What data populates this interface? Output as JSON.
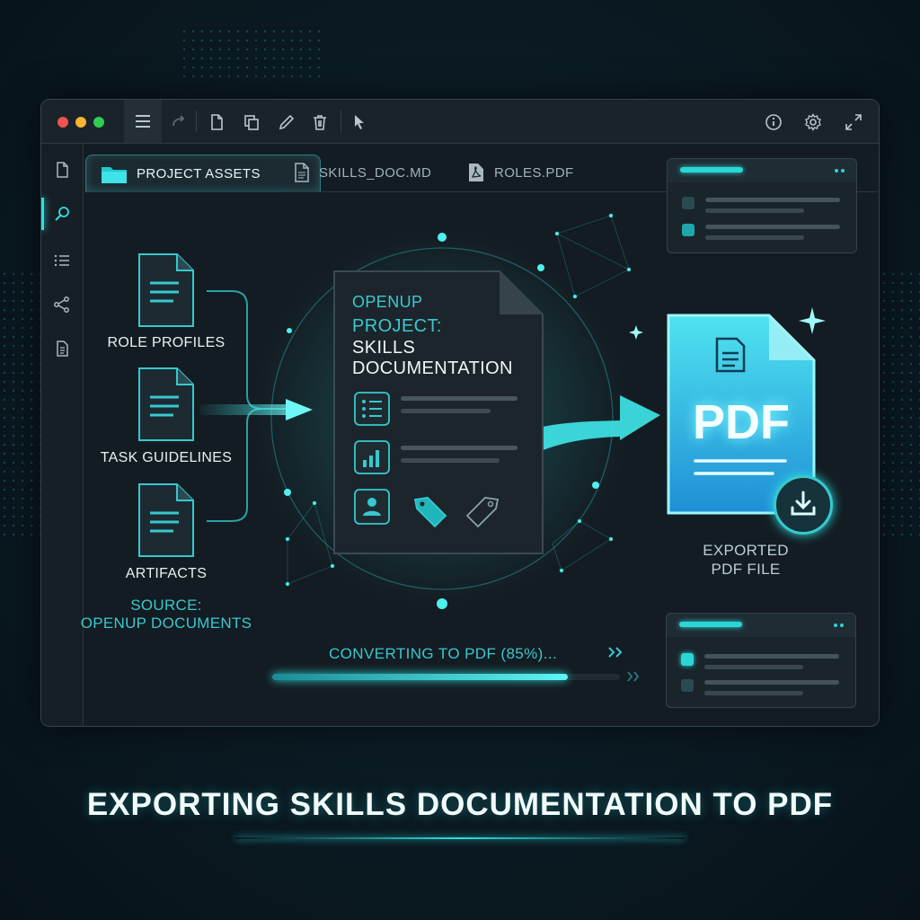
{
  "toolbar": {
    "icons": [
      "menu-icon",
      "redo-icon",
      "new-file-icon",
      "copy-icon",
      "edit-icon",
      "delete-icon",
      "pointer-icon",
      "info-icon",
      "settings-icon",
      "expand-icon"
    ]
  },
  "sidebar": {
    "items": [
      "file-icon",
      "search-icon",
      "list-icon",
      "share-icon",
      "document-icon"
    ],
    "active": "search-icon"
  },
  "tabs": [
    {
      "label": "PROJECT ASSETS",
      "icon": "folder-icon",
      "active": true
    },
    {
      "label": "SKILLS_DOC.MD",
      "icon": "file-icon",
      "active": false
    },
    {
      "label": "ROLES.PDF",
      "icon": "pdf-icon",
      "active": false
    }
  ],
  "sources": {
    "items": [
      {
        "label": "ROLE PROFILES"
      },
      {
        "label": "TASK GUIDELINES"
      },
      {
        "label": "ARTIFACTS"
      }
    ],
    "caption_line1": "SOURCE:",
    "caption_line2": "OPENUP DOCUMENTS"
  },
  "main_doc": {
    "line1": "OPENUP",
    "line2": "PROJECT:",
    "line3": "SKILLS",
    "line4": "DOCUMENTATION"
  },
  "export": {
    "badge": "PDF",
    "caption_line1": "EXPORTED",
    "caption_line2": "PDF FILE"
  },
  "progress": {
    "label": "CONVERTING TO PDF (85%)...",
    "value": 0.85
  },
  "footer": {
    "title": "EXPORTING SKILLS DOCUMENTATION TO PDF"
  },
  "colors": {
    "accent": "#2fe0e0",
    "background": "#0c1c24"
  }
}
